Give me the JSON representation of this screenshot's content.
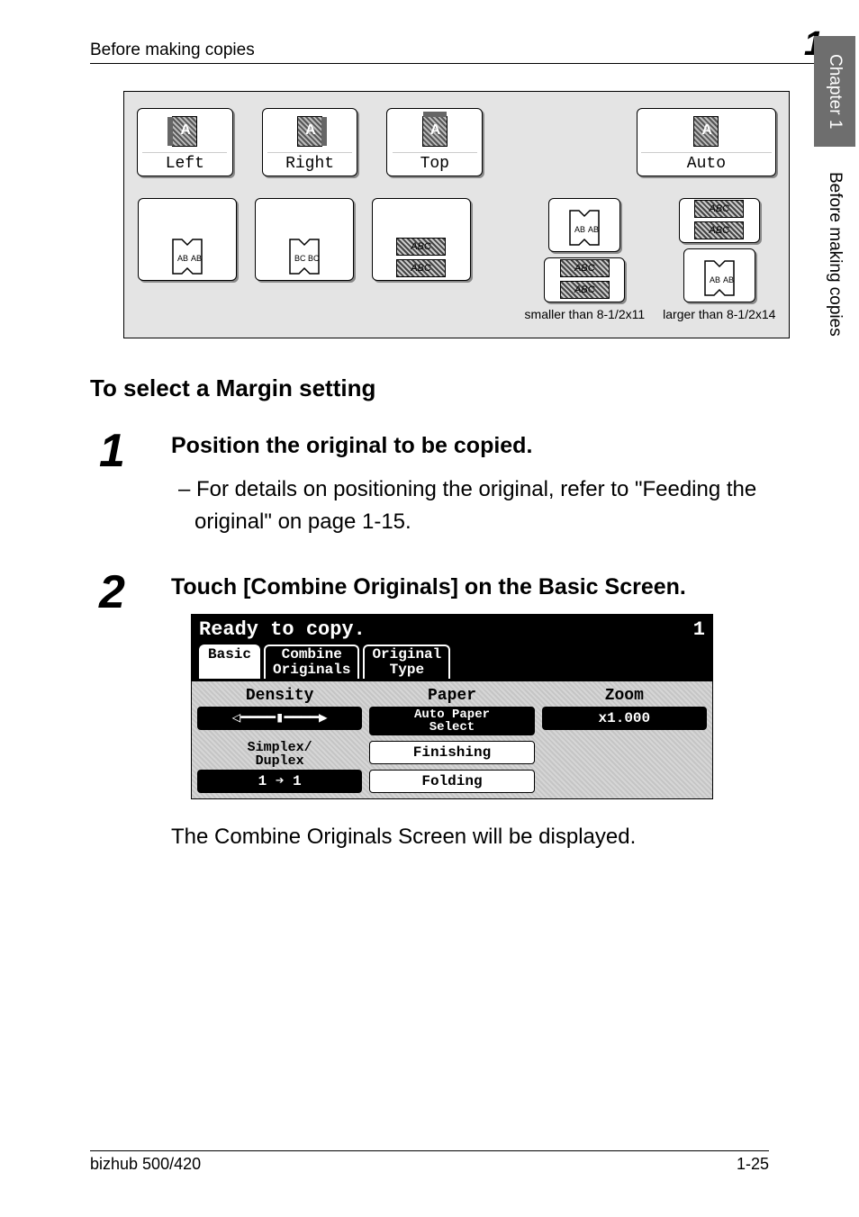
{
  "header": {
    "section": "Before making copies",
    "chapter_number": "1"
  },
  "side_tab": {
    "chapter": "Chapter 1",
    "section": "Before making copies"
  },
  "margin_figure": {
    "row1": [
      "Left",
      "Right",
      "Top",
      "Auto"
    ],
    "row2_sheets": {
      "a": "ABC",
      "b": "ABC"
    },
    "auto_captions": {
      "smaller": "smaller than\n8-1/2x11",
      "larger": "larger than\n8-1/2x14"
    },
    "book_labels": {
      "ab": "AB",
      "bc": "BC"
    }
  },
  "heading": "To select a Margin setting",
  "steps": {
    "s1": {
      "num": "1",
      "title": "Position the original to be copied.",
      "detail": "For details on positioning the original, refer to \"Feeding the original\" on page 1-15."
    },
    "s2": {
      "num": "2",
      "title": "Touch [Combine Originals] on the Basic Screen.",
      "after": "The Combine Originals Screen will be displayed."
    }
  },
  "panel": {
    "status": "Ready to copy.",
    "copies": "1",
    "tabs": {
      "basic": "Basic",
      "combine": "Combine\nOriginals",
      "original": "Original\nType"
    },
    "cells": {
      "density_label": "Density",
      "density_value": "◁━━━━▮━━━━▶",
      "paper_label": "Paper",
      "paper_value": "Auto Paper\nSelect",
      "zoom_label": "Zoom",
      "zoom_value": "x1.000",
      "simplex_label": "Simplex/\nDuplex",
      "simplex_value": "1 ➔ 1",
      "finishing_label": "Finishing",
      "folding_label": "Folding"
    }
  },
  "footer": {
    "left": "bizhub 500/420",
    "right": "1-25"
  }
}
